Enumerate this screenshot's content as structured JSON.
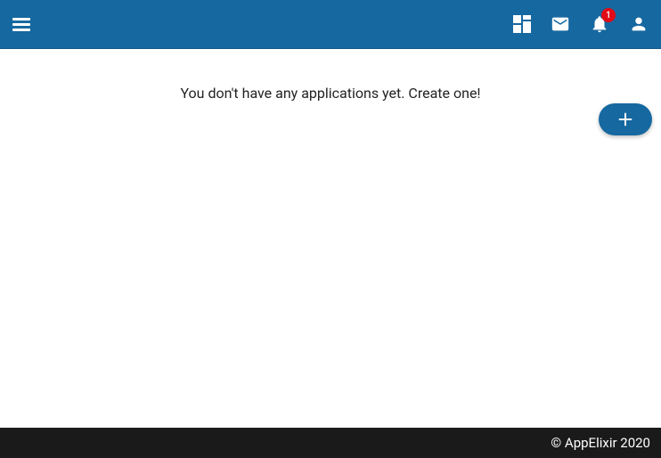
{
  "header": {
    "notification_count": "1"
  },
  "main": {
    "empty_message": "You don't have any applications yet. Create one!"
  },
  "footer": {
    "copyright": "© AppElixir 2020"
  }
}
